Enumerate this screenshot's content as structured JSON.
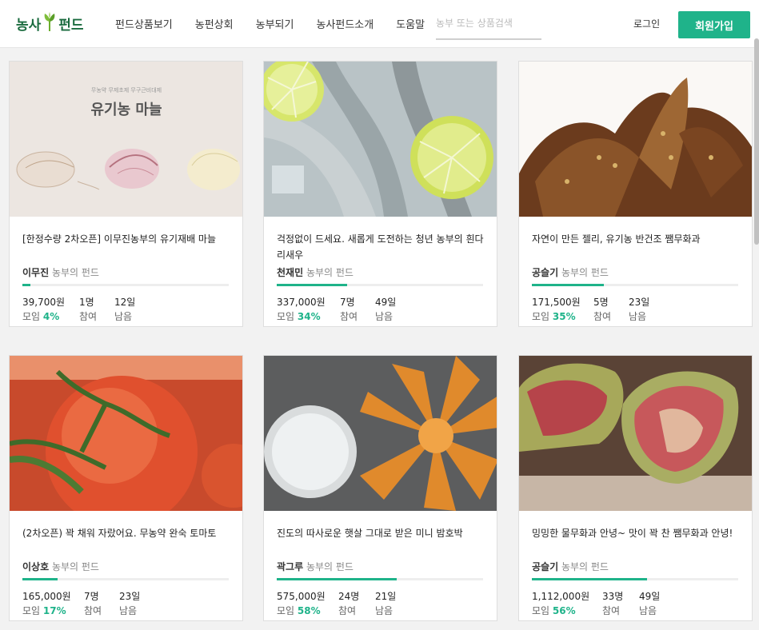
{
  "header": {
    "logo_text_a": "농사",
    "logo_text_b": "펀드",
    "nav": [
      "펀드상품보기",
      "농펀상회",
      "농부되기",
      "농사펀드소개",
      "도움말"
    ],
    "search_placeholder": "농부 또는 상품검색",
    "login": "로그인",
    "signup": "회원가입"
  },
  "labels": {
    "farmer_suffix": "농부의 펀드",
    "raised": "모임",
    "participants": "참여",
    "remaining": "남음"
  },
  "cards": [
    {
      "image": "organic-garlic",
      "banner_sub": "무농약   무제초제   무구근비대제",
      "banner_title": "유기농 마늘",
      "title": "[한정수량 2차오픈] 이무진농부의 유기재배 마늘",
      "farmer": "이무진",
      "amount": "39,700원",
      "people": "1명",
      "days": "12일",
      "percent": "4%",
      "progress": 0.04
    },
    {
      "image": "shrimp-lime",
      "title": "걱정없이 드세요. 새롭게 도전하는 청년 농부의 흰다리새우",
      "farmer": "천재민",
      "amount": "337,000원",
      "people": "7명",
      "days": "49일",
      "percent": "34%",
      "progress": 0.34
    },
    {
      "image": "dried-figs",
      "title": "자연이 만든 젤리, 유기농 반건조 쨈무화과",
      "farmer": "공슬기",
      "amount": "171,500원",
      "people": "5명",
      "days": "23일",
      "percent": "35%",
      "progress": 0.35
    },
    {
      "image": "tomatoes",
      "title": "(2차오픈) 꽉 채워 자랐어요. 무농약 완숙 토마토",
      "farmer": "이상호",
      "amount": "165,000원",
      "people": "7명",
      "days": "23일",
      "percent": "17%",
      "progress": 0.17
    },
    {
      "image": "sweet-pumpkin",
      "title": "진도의 따사로운 햇살 그대로 받은 미니 밤호박",
      "farmer": "곽그루",
      "amount": "575,000원",
      "people": "24명",
      "days": "21일",
      "percent": "58%",
      "progress": 0.58
    },
    {
      "image": "fresh-fig",
      "title": "밍밍한 물무화과 안녕~ 맛이 꽉 찬 쨈무화과 안녕!",
      "farmer": "공슬기",
      "amount": "1,112,000원",
      "people": "33명",
      "days": "49일",
      "percent": "56%",
      "progress": 0.56
    }
  ],
  "colors": {
    "accent": "#1fb38a",
    "logo": "#1a6b3e"
  }
}
